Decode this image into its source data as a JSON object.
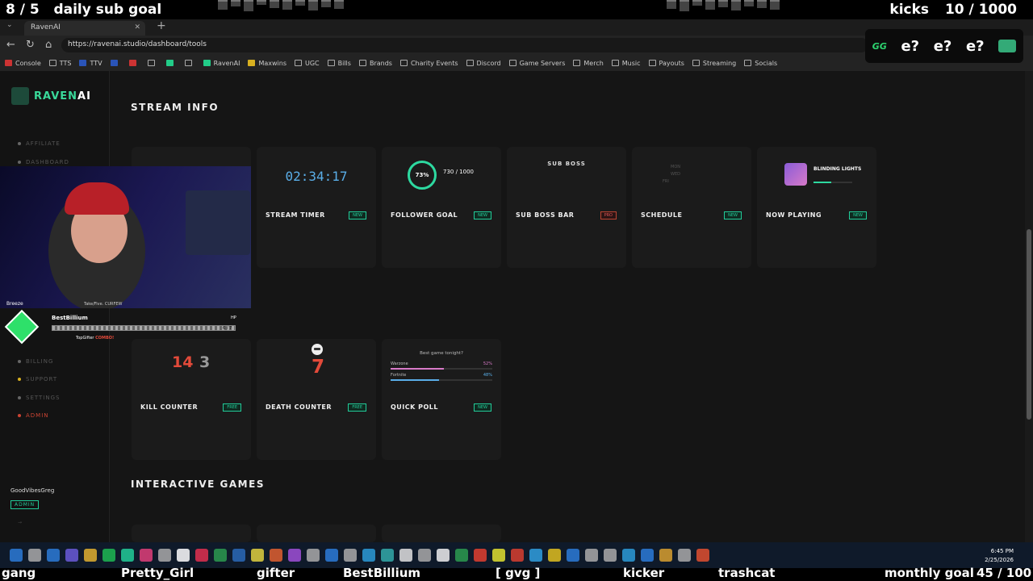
{
  "overlay_top": {
    "sub_count": "8 / 5",
    "sub_goal_label": "daily sub goal",
    "kicks_label": "kicks",
    "kicks_count": "10 / 1000"
  },
  "browser": {
    "tab_title": "RavenAI",
    "url": "https://ravenai.studio/dashboard/tools",
    "bookmarks": [
      {
        "label": "Console",
        "icon": "red"
      },
      {
        "label": "TTS",
        "icon": ""
      },
      {
        "label": "TTV",
        "icon": "blue"
      },
      {
        "label": "",
        "icon": "blue"
      },
      {
        "label": "",
        "icon": "red"
      },
      {
        "label": "",
        "icon": ""
      },
      {
        "label": "",
        "icon": "green"
      },
      {
        "label": "",
        "icon": ""
      },
      {
        "label": "RavenAI",
        "icon": "green"
      },
      {
        "label": "Maxwins",
        "icon": "yel"
      },
      {
        "label": "UGC",
        "icon": ""
      },
      {
        "label": "Bills",
        "icon": ""
      },
      {
        "label": "Brands",
        "icon": ""
      },
      {
        "label": "Charity Events",
        "icon": ""
      },
      {
        "label": "Discord",
        "icon": ""
      },
      {
        "label": "Game Servers",
        "icon": ""
      },
      {
        "label": "Merch",
        "icon": ""
      },
      {
        "label": "Music",
        "icon": ""
      },
      {
        "label": "Payouts",
        "icon": ""
      },
      {
        "label": "Streaming",
        "icon": ""
      },
      {
        "label": "Socials",
        "icon": ""
      }
    ]
  },
  "emote_box": {
    "gg": "GG",
    "e1": "e?",
    "e2": "e?",
    "e3": "e?"
  },
  "sidebar": {
    "logo_a": "RAVEN",
    "logo_b": "AI",
    "items": [
      {
        "label": "AFFILIATE",
        "cls": ""
      },
      {
        "label": "DASHBOARD",
        "cls": ""
      },
      {
        "label": "BILLING",
        "cls": ""
      },
      {
        "label": "SUPPORT",
        "cls": "support"
      },
      {
        "label": "SETTINGS",
        "cls": ""
      },
      {
        "label": "ADMIN",
        "cls": "admin"
      }
    ],
    "username": "GoodVibesGreg",
    "role": "ADMIN"
  },
  "stream_info": {
    "title": "STREAM INFO",
    "cards": [
      {
        "name": "STREAM TIMER",
        "badge": "NEW",
        "timer": "02:34:17"
      },
      {
        "name": "FOLLOWER GOAL",
        "badge": "NEW",
        "ring": "73%",
        "goal": "730 / 1000",
        "progress": 0.73
      },
      {
        "name": "SUB BOSS BAR",
        "badge": "PRO",
        "boss_title": "SUB BOSS"
      },
      {
        "name": "SCHEDULE",
        "badge": "NEW",
        "days": [
          "MON",
          "WED",
          "FRI"
        ]
      },
      {
        "name": "NOW PLAYING",
        "badge": "NEW",
        "track": "BLINDING LIGHTS"
      }
    ]
  },
  "game_tools": {
    "cards": [
      {
        "name": "KILL COUNTER",
        "badge": "FREE",
        "kills": "14",
        "deaths": "3"
      },
      {
        "name": "DEATH COUNTER",
        "badge": "FREE",
        "deaths": "7"
      },
      {
        "name": "QUICK POLL",
        "badge": "NEW",
        "question": "Best game tonight?",
        "options": [
          {
            "label": "Warzone",
            "pct": "52%",
            "value": 52
          },
          {
            "label": "Fortnite",
            "pct": "48%",
            "value": 48
          }
        ]
      }
    ]
  },
  "interactive_games": {
    "title": "INTERACTIVE GAMES"
  },
  "webcam": {
    "name": "Breeze",
    "song": "Take/Five. CURFEW"
  },
  "hp_widget": {
    "player": "BestBillium",
    "hp_label": "HP",
    "hp_value": "6 / 7",
    "gifter": "TopGifter",
    "gifter_note": "COMBO!"
  },
  "clock": {
    "time": "6:45 PM",
    "date": "2/25/2026"
  },
  "ticker": [
    {
      "text": "gang"
    },
    {
      "text": "Pretty_Girl"
    },
    {
      "text": "gifter"
    },
    {
      "text": "BestBillium"
    },
    {
      "text": "[ gvg ]"
    },
    {
      "text": "kicker"
    },
    {
      "text": "trashcat"
    },
    {
      "text": "monthly goal"
    },
    {
      "text": "45 / 100"
    }
  ]
}
